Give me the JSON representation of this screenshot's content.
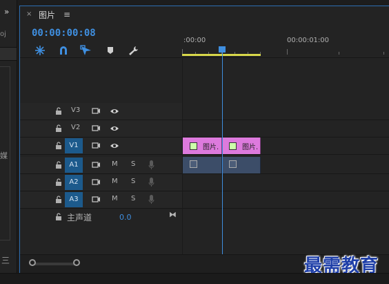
{
  "left_panel": {
    "collapse_glyph": "»",
    "partial_label": "oj",
    "partial_vertical_text": "媒",
    "menu_glyph": "三"
  },
  "sequence_panel": {
    "close_glyph": "×",
    "title": "图片",
    "menu_glyph": "≡",
    "timecode": "00:00:00:08",
    "tools": [
      "snap-icon",
      "linked-selection-icon",
      "add-marker-icon",
      "marker-icon",
      "wrench-icon"
    ],
    "ruler": {
      "labels": [
        ":00:00",
        "00:00:01:00"
      ]
    },
    "tracks": [
      {
        "name": "V3",
        "targeted": false,
        "type": "video",
        "has_clip": false
      },
      {
        "name": "V2",
        "targeted": false,
        "type": "video",
        "has_clip": false
      },
      {
        "name": "V1",
        "targeted": true,
        "type": "video",
        "has_clip": true
      },
      {
        "name": "A1",
        "targeted": true,
        "type": "audio",
        "has_clip": true,
        "mute": "M",
        "solo": "S"
      },
      {
        "name": "A2",
        "targeted": true,
        "type": "audio",
        "has_clip": false,
        "mute": "M",
        "solo": "S"
      },
      {
        "name": "A3",
        "targeted": true,
        "type": "audio",
        "has_clip": false,
        "mute": "M",
        "solo": "S"
      }
    ],
    "clips": {
      "v1": [
        {
          "label": "图片."
        },
        {
          "label": "图片."
        }
      ],
      "a1": [
        {
          "label": ""
        },
        {
          "label": ""
        }
      ]
    },
    "master": {
      "label": "主声道",
      "value": "0.0",
      "split_glyph": "⧓"
    }
  },
  "watermark": "最需教育",
  "colors": {
    "accent": "#3f8fe0",
    "video_clip": "#dd7add",
    "audio_clip": "#3c4d68",
    "work_area": "#d8d84a",
    "watermark": "#1f3fa8"
  }
}
